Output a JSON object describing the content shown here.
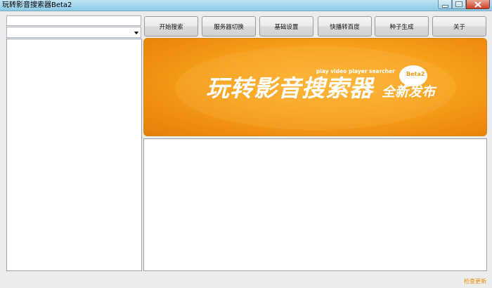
{
  "window": {
    "title": "玩转影音搜索器Beta2",
    "controls": [
      "minimize-icon",
      "maximize-icon",
      "close-icon"
    ]
  },
  "search": {
    "query": "",
    "selected_option": ""
  },
  "toolbar": {
    "buttons": [
      "开始搜索",
      "服务器切换",
      "基础设置",
      "快播转百度",
      "种子生成",
      "关于"
    ]
  },
  "banner": {
    "tagline": "play video player searcher",
    "bubble": "Beta2",
    "title": "玩转影音搜索器",
    "subtitle": "全新发布",
    "colors": {
      "background": "#f7a01d",
      "text": "#ffffff"
    }
  },
  "status": {
    "check_update": "检查更新",
    "accent_color": "#f08a00"
  }
}
